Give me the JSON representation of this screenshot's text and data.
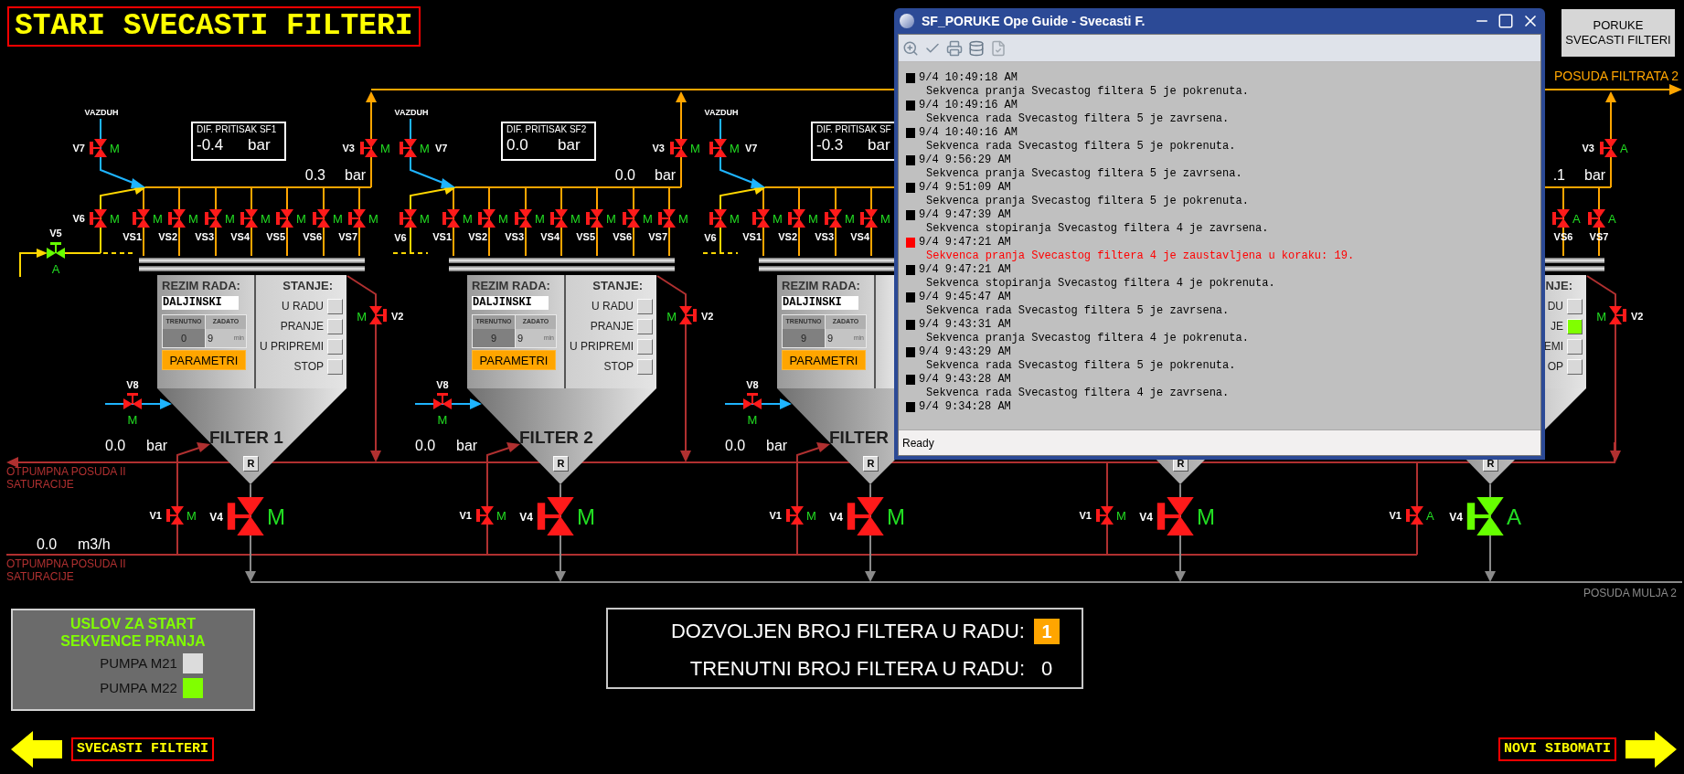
{
  "title": "STARI SVECASTI FILTERI",
  "messages_button": {
    "lines": [
      "PORUKE",
      "SVECASTI FILTERI"
    ]
  },
  "outlets": {
    "filtrate": "POSUDA FILTRATA 2",
    "sludge": "POSUDA MULJA 2",
    "return_1": "OTPUMPNA POSUDA II SATURACIJE",
    "return_2": "OTPUMPNA POSUDA II SATURACIJE"
  },
  "flow": {
    "value": "0.0",
    "unit": "m3/h"
  },
  "filters": [
    {
      "vazduh": "VAZDUH",
      "v7": {
        "label": "V7",
        "mode": "M",
        "open": false
      },
      "dif": {
        "title": "DIF. PRITISAK SF1",
        "value": "-0.4",
        "unit": "bar"
      },
      "pressure": {
        "value": "0.3",
        "unit": "bar"
      },
      "v3": {
        "label": "V3",
        "mode": "M",
        "open": false
      },
      "v6": {
        "label": "V6",
        "mode": "M",
        "open": false
      },
      "vs": [
        {
          "label": "VS1",
          "mode": "M",
          "open": false
        },
        {
          "label": "VS2",
          "mode": "M",
          "open": false
        },
        {
          "label": "VS3",
          "mode": "M",
          "open": false
        },
        {
          "label": "VS4",
          "mode": "M",
          "open": false
        },
        {
          "label": "VS5",
          "mode": "M",
          "open": false
        },
        {
          "label": "VS6",
          "mode": "M",
          "open": false
        },
        {
          "label": "VS7",
          "mode": "M",
          "open": false
        }
      ],
      "v5": {
        "label": "V5",
        "mode": "A",
        "open": true
      },
      "mode_panel": {
        "title": "REZIM RADA:",
        "mode": "DALJINSKI",
        "col_1": "TRENUTNO",
        "col_2": "ZADATO",
        "current": "0",
        "set": "9",
        "unit": "min",
        "button": "PARAMETRI"
      },
      "state_panel": {
        "title": "STANJE:",
        "items": [
          {
            "label": "U RADU",
            "on": false
          },
          {
            "label": "PRANJE",
            "on": false
          },
          {
            "label": "U PRIPREMI",
            "on": false
          },
          {
            "label": "STOP",
            "on": false
          }
        ]
      },
      "v8": {
        "label": "V8",
        "mode": "M",
        "open": false
      },
      "bottom_pressure": {
        "value": "0.0",
        "unit": "bar"
      },
      "name": "FILTER 1",
      "reset": "R",
      "v2": {
        "label": "V2",
        "mode": "M",
        "open": false
      },
      "v1": {
        "label": "V1",
        "mode": "M",
        "open": false
      },
      "v4": {
        "label": "V4",
        "mode": "M",
        "open": false
      }
    },
    {
      "vazduh": "VAZDUH",
      "v7": {
        "label": "V7",
        "mode": "M",
        "open": false
      },
      "dif": {
        "title": "DIF. PRITISAK SF2",
        "value": "0.0",
        "unit": "bar"
      },
      "pressure": {
        "value": "0.0",
        "unit": "bar"
      },
      "v3": {
        "label": "V3",
        "mode": "M",
        "open": false
      },
      "v6": {
        "label": "V6",
        "mode": "M",
        "open": false
      },
      "vs": [
        {
          "label": "VS1",
          "mode": "M",
          "open": false
        },
        {
          "label": "VS2",
          "mode": "M",
          "open": false
        },
        {
          "label": "VS3",
          "mode": "M",
          "open": false
        },
        {
          "label": "VS4",
          "mode": "M",
          "open": false
        },
        {
          "label": "VS5",
          "mode": "M",
          "open": false
        },
        {
          "label": "VS6",
          "mode": "M",
          "open": false
        },
        {
          "label": "VS7",
          "mode": "M",
          "open": false
        }
      ],
      "mode_panel": {
        "title": "REZIM RADA:",
        "mode": "DALJINSKI",
        "col_1": "TRENUTNO",
        "col_2": "ZADATO",
        "current": "9",
        "set": "9",
        "unit": "min",
        "button": "PARAMETRI"
      },
      "state_panel": {
        "title": "STANJE:",
        "items": [
          {
            "label": "U RADU",
            "on": false
          },
          {
            "label": "PRANJE",
            "on": false
          },
          {
            "label": "U PRIPREMI",
            "on": false
          },
          {
            "label": "STOP",
            "on": false
          }
        ]
      },
      "v8": {
        "label": "V8",
        "mode": "M",
        "open": false
      },
      "bottom_pressure": {
        "value": "0.0",
        "unit": "bar"
      },
      "name": "FILTER 2",
      "reset": "R",
      "v2": {
        "label": "V2",
        "mode": "M",
        "open": false
      },
      "v1": {
        "label": "V1",
        "mode": "M",
        "open": false
      },
      "v4": {
        "label": "V4",
        "mode": "M",
        "open": false
      }
    },
    {
      "vazduh": "VAZDUH",
      "v7": {
        "label": "V7",
        "mode": "M",
        "open": false
      },
      "dif": {
        "title": "DIF. PRITISAK SF",
        "value": "-0.3",
        "unit": "bar"
      },
      "v6": {
        "label": "V6",
        "mode": "M",
        "open": false
      },
      "vs": [
        {
          "label": "VS1",
          "mode": "M",
          "open": false
        },
        {
          "label": "VS2",
          "mode": "M",
          "open": false
        },
        {
          "label": "VS3",
          "mode": "M",
          "open": false
        },
        {
          "label": "VS4",
          "mode": "M",
          "open": false
        }
      ],
      "mode_panel": {
        "title": "REZIM RADA:",
        "mode": "DALJINSKI",
        "col_1": "TRENUTNO",
        "col_2": "ZADATO",
        "current": "9",
        "set": "9",
        "unit": "min",
        "button": "PARAMETRI"
      },
      "v8": {
        "label": "V8",
        "mode": "M",
        "open": false
      },
      "bottom_pressure": {
        "value": "0.0",
        "unit": "bar"
      },
      "name": "FILTER",
      "reset": "R",
      "v1": {
        "label": "V1",
        "mode": "M",
        "open": false
      },
      "v4": {
        "label": "V4",
        "mode": "M",
        "open": false
      }
    },
    {
      "reset": "R",
      "v1": {
        "label": "V1",
        "mode": "M",
        "open": false
      },
      "v4": {
        "label": "V4",
        "mode": "M",
        "open": false
      }
    },
    {
      "pressure": {
        "value": ".1",
        "unit": "bar"
      },
      "v3": {
        "label": "V3",
        "mode": "A",
        "open": false
      },
      "vs": [
        {
          "label": "VS6",
          "mode": "A",
          "open": false
        },
        {
          "label": "VS7",
          "mode": "A",
          "open": false
        }
      ],
      "state_panel": {
        "title": "NJE:",
        "items": [
          {
            "label": "DU",
            "on": false
          },
          {
            "label": "JE",
            "on": true
          },
          {
            "label": "EMI",
            "on": false
          },
          {
            "label": "OP",
            "on": false
          }
        ]
      },
      "reset": "R",
      "v2": {
        "label": "V2",
        "mode": "M",
        "open": false
      },
      "v1": {
        "label": "V1",
        "mode": "A",
        "open": false
      },
      "v4": {
        "label": "V4",
        "mode": "A",
        "open": true
      }
    }
  ],
  "conditions": {
    "title_lines": [
      "USLOV ZA START",
      "SEKVENCE PRANJA"
    ],
    "pumps": [
      {
        "label": "PUMPA M21",
        "on": false
      },
      {
        "label": "PUMPA M22",
        "on": true
      }
    ]
  },
  "counts": [
    {
      "kind": "setpoint",
      "label": "DOZVOLJEN BROJ FILTERA U RADU:",
      "value": "1"
    },
    {
      "kind": "reading",
      "label": "TRENUTNI BROJ FILTERA U RADU:",
      "value": "0"
    }
  ],
  "nav": [
    {
      "kind": "left",
      "label": "SVECASTI FILTERI"
    },
    {
      "kind": "right",
      "label": "NOVI SIBOMATI"
    }
  ],
  "window": {
    "title": "SF_PORUKE Ope Guide - Svecasti F.",
    "status": "Ready",
    "messages": [
      {
        "time": "9/4 10:49:18 AM",
        "text": "Sekvenca pranja Svecastog filtera 5 je pokrenuta.",
        "color": "#000000"
      },
      {
        "time": "9/4 10:49:16 AM",
        "text": "Sekvenca rada Svecastog filtera 5 je zavrsena.",
        "color": "#000000"
      },
      {
        "time": "9/4 10:40:16 AM",
        "text": "Sekvenca rada Svecastog filtera 5 je pokrenuta.",
        "color": "#000000"
      },
      {
        "time": "9/4 9:56:29 AM",
        "text": "Sekvenca pranja Svecastog filtera 5 je zavrsena.",
        "color": "#000000"
      },
      {
        "time": "9/4 9:51:09 AM",
        "text": "Sekvenca pranja Svecastog filtera 5 je pokrenuta.",
        "color": "#000000"
      },
      {
        "time": "9/4 9:47:39 AM",
        "text": "Sekvenca stopiranja Svecastog filtera 4 je zavrsena.",
        "color": "#000000"
      },
      {
        "time": "9/4 9:47:21 AM",
        "text": "Sekvenca pranja Svecastog filtera 4 je zaustavljena u koraku: 19.",
        "color": "#ff0000"
      },
      {
        "time": "9/4 9:47:21 AM",
        "text": "Sekvenca stopiranja Svecastog filtera 4 je pokrenuta.",
        "color": "#000000"
      },
      {
        "time": "9/4 9:45:47 AM",
        "text": "Sekvenca rada Svecastog filtera 5 je zavrsena.",
        "color": "#000000"
      },
      {
        "time": "9/4 9:43:31 AM",
        "text": "Sekvenca pranja Svecastog filtera 4 je pokrenuta.",
        "color": "#000000"
      },
      {
        "time": "9/4 9:43:29 AM",
        "text": "Sekvenca rada Svecastog filtera 5 je pokrenuta.",
        "color": "#000000"
      },
      {
        "time": "9/4 9:43:28 AM",
        "text": "Sekvenca rada Svecastog filtera 4 je zavrsena.",
        "color": "#000000"
      },
      {
        "time": "9/4 9:34:28 AM",
        "color": "#000000"
      }
    ]
  }
}
